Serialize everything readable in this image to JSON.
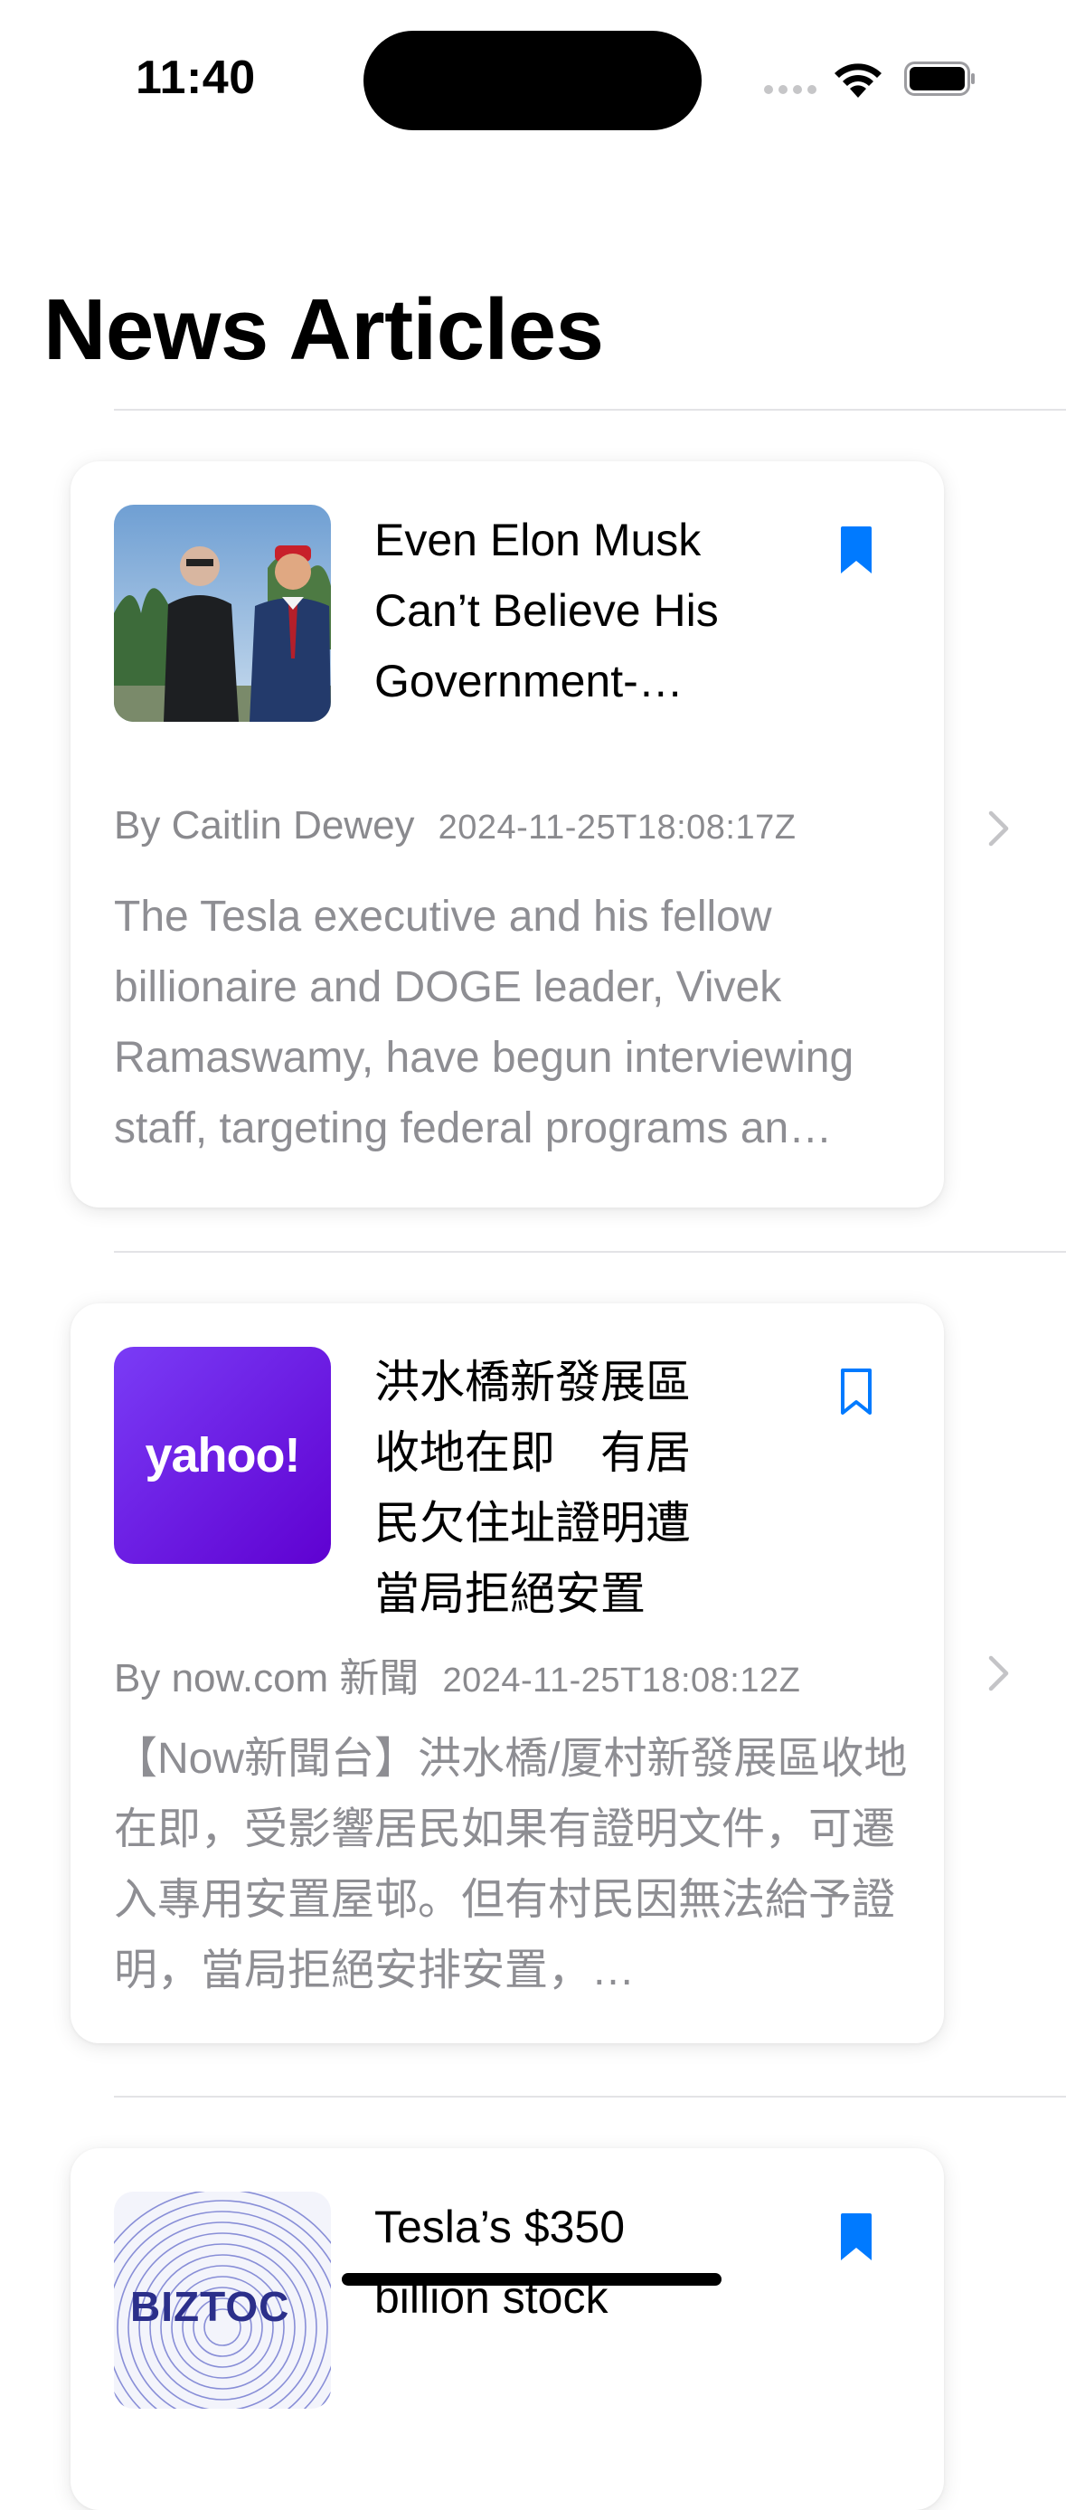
{
  "status_bar": {
    "time": "11:40"
  },
  "page": {
    "title": "News Articles"
  },
  "colors": {
    "accent": "#007AFF",
    "secondary_text": "#8E8E93"
  },
  "articles": [
    {
      "title": "Even Elon Musk Can’t Believe His Government-…",
      "author": "By Caitlin Dewey",
      "date": "2024-11-25T18:08:17Z",
      "summary": "The Tesla executive and his fellow billionaire and DOGE leader, Vivek Ramaswamy, have begun interviewing staff, targeting federal programs an…",
      "bookmarked": true,
      "thumbnail": "photo-two-men-outdoors"
    },
    {
      "title": "洪水橋新發展區收地在即　有居民欠住址證明遭當局拒絕安置",
      "author": "By now.com 新聞",
      "date": "2024-11-25T18:08:12Z",
      "summary": "【Now新聞台】洪水橋/厦村新發展區收地在即，受影響居民如果有證明文件，可遷入專用安置屋邨。但有村民因無法給予證明，當局拒絕安排安置，…",
      "bookmarked": false,
      "thumbnail": "yahoo-logo",
      "thumbnail_text": "yahoo!"
    },
    {
      "title": "Tesla’s $350 billion stock",
      "bookmarked": true,
      "thumbnail": "biztoc-logo",
      "thumbnail_text": "BIZTOC"
    }
  ]
}
